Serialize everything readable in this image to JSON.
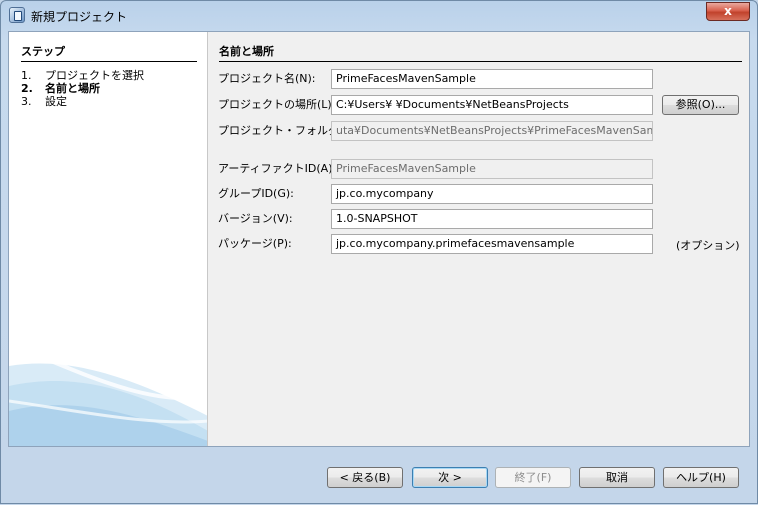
{
  "window": {
    "title": "新規プロジェクト",
    "close_label": "x"
  },
  "steps": {
    "header": "ステップ",
    "items": [
      {
        "num": "1.",
        "label": "プロジェクトを選択"
      },
      {
        "num": "2.",
        "label": "名前と場所"
      },
      {
        "num": "3.",
        "label": "設定"
      }
    ]
  },
  "form": {
    "section_title": "名前と場所",
    "project_name": {
      "label": "プロジェクト名(N):",
      "value": "PrimeFacesMavenSample"
    },
    "project_location": {
      "label": "プロジェクトの場所(L):",
      "value": "C:¥Users¥          ¥Documents¥NetBeansProjects"
    },
    "browse_label": "参照(O)...",
    "project_folder": {
      "label": "プロジェクト・フォルダ(D):",
      "value": "uta¥Documents¥NetBeansProjects¥PrimeFacesMavenSample"
    },
    "artifact_id": {
      "label": "アーティファクトID(A):",
      "value": "PrimeFacesMavenSample"
    },
    "group_id": {
      "label": "グループID(G):",
      "value": "jp.co.mycompany"
    },
    "version": {
      "label": "バージョン(V):",
      "value": "1.0-SNAPSHOT"
    },
    "package": {
      "label": "パッケージ(P):",
      "value": "jp.co.mycompany.primefacesmavensample"
    },
    "optional_note": "(オプション)"
  },
  "buttons": {
    "back": "< 戻る(B)",
    "next": "次 >",
    "finish": "終了(F)",
    "cancel": "取消",
    "help": "ヘルプ(H)"
  }
}
